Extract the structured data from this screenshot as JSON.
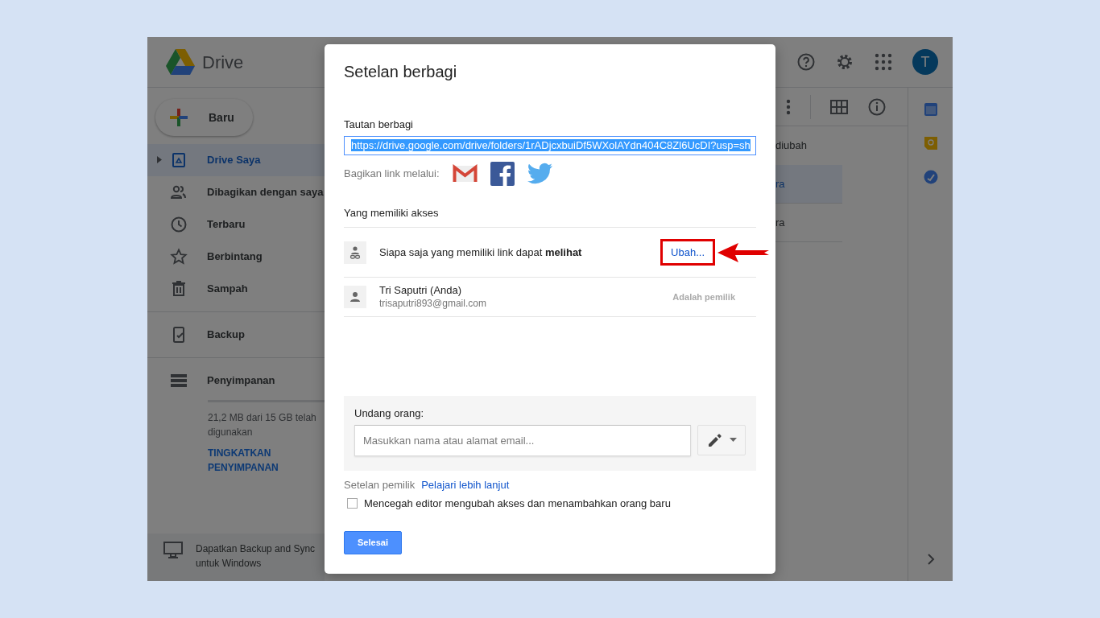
{
  "app": {
    "logo_text": "Drive",
    "avatar_letter": "T",
    "new_button": "Baru",
    "nav": [
      {
        "kind": "drive",
        "label": "Drive Saya",
        "selected": true
      },
      {
        "kind": "shared",
        "label": "Dibagikan dengan saya",
        "selected": false
      },
      {
        "kind": "recent",
        "label": "Terbaru",
        "selected": false
      },
      {
        "kind": "starred",
        "label": "Berbintang",
        "selected": false
      },
      {
        "kind": "trash",
        "label": "Sampah",
        "selected": false
      }
    ],
    "backup": {
      "kind": "backup",
      "label": "Backup"
    },
    "storage": {
      "label": "Penyimpanan",
      "usage": "21,2 MB dari 15 GB telah digunakan",
      "upgrade": "TINGKATKAN PENYIMPANAN"
    },
    "promo": "Dapatkan Backup and Sync untuk Windows",
    "list": {
      "column_header": "diubah",
      "rows": [
        {
          "text": "ra",
          "selected": true
        },
        {
          "text": "ra",
          "selected": false
        }
      ]
    }
  },
  "dialog": {
    "title": "Setelan berbagi",
    "link_label": "Tautan berbagi",
    "link": "https://drive.google.com/drive/folders/1rADjcxbuiDf5WXolAYdn404C8Zl6UcDI?usp=sh",
    "share_via": "Bagikan link melalui:",
    "access_heading": "Yang memiliki akses",
    "access": [
      {
        "kind": "link",
        "text": "Siapa saja yang memiliki link dapat **melihat**",
        "action": "Ubah...",
        "highlighted": true
      },
      {
        "kind": "person",
        "name": "Tri Saputri (Anda)",
        "email": "trisaputri893@gmail.com",
        "role": "Adalah pemilik"
      }
    ],
    "invite": {
      "label": "Undang orang:",
      "placeholder": "Masukkan nama atau alamat email..."
    },
    "owner_settings": "Setelan pemilik",
    "learn_more": "Pelajari lebih lanjut",
    "option": {
      "label": "Mencegah editor mengubah akses dan menambahkan orang baru",
      "checked": false
    },
    "done_button": "Selesai"
  }
}
